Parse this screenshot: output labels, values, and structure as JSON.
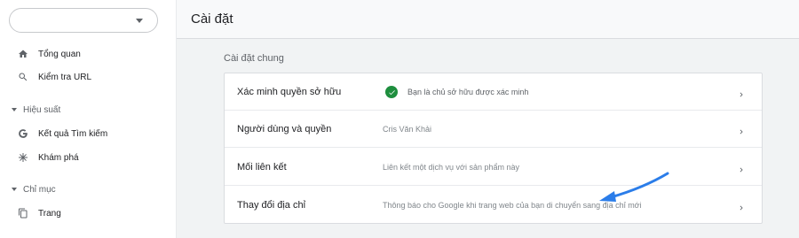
{
  "sidebar": {
    "property_selector": "",
    "items": [
      {
        "label": "Tổng quan",
        "icon": "home-icon"
      },
      {
        "label": "Kiểm tra URL",
        "icon": "search-icon"
      }
    ],
    "sections": [
      {
        "label": "Hiệu suất",
        "items": [
          {
            "label": "Kết quả Tìm kiếm",
            "icon": "google-g-icon"
          },
          {
            "label": "Khám phá",
            "icon": "asterisk-icon"
          }
        ]
      },
      {
        "label": "Chỉ mục",
        "items": [
          {
            "label": "Trang",
            "icon": "pages-icon"
          }
        ]
      }
    ]
  },
  "header": {
    "title": "Cài đặt"
  },
  "main": {
    "section_title": "Cài đặt chung",
    "rows": [
      {
        "label": "Xác minh quyền sở hữu",
        "value": "Bạn là chủ sở hữu được xác minh"
      },
      {
        "label": "Người dùng và quyền",
        "value": "Cris Văn Khải"
      },
      {
        "label": "Mối liên kết",
        "value": "Liên kết một dịch vụ với sản phẩm này"
      },
      {
        "label": "Thay đổi địa chỉ",
        "value": "Thông báo cho Google khi trang web của bạn di chuyển sang địa chỉ mới"
      }
    ]
  },
  "colors": {
    "verified": "#1e8e3e",
    "annotation_arrow": "#2b7de9"
  }
}
